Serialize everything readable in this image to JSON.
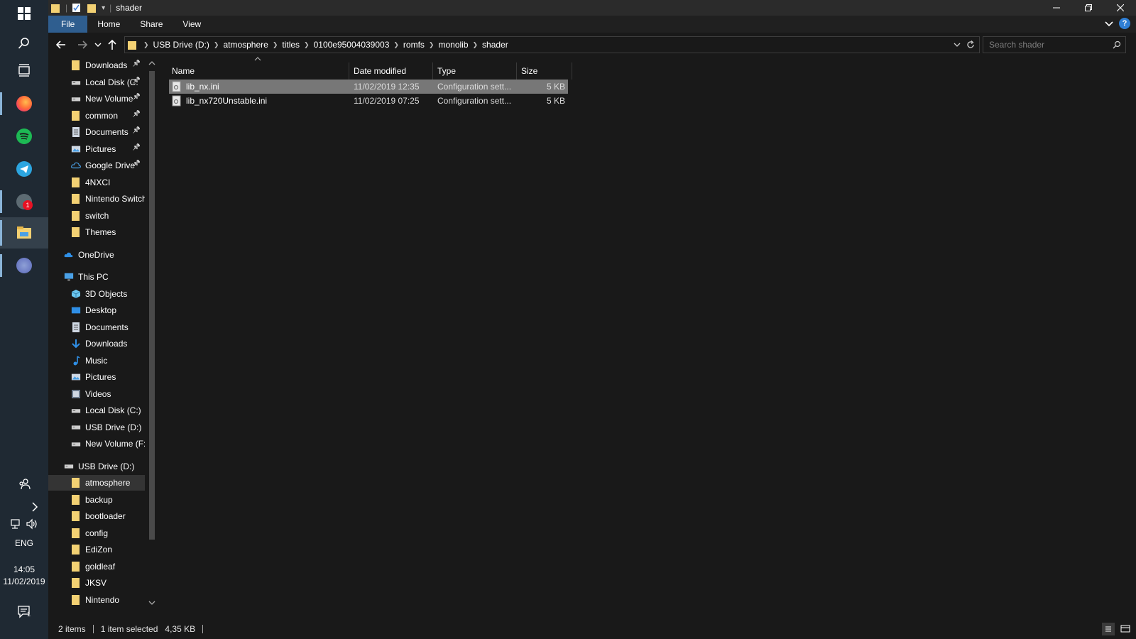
{
  "window": {
    "title": "shader"
  },
  "ribbon": {
    "tabs": [
      "File",
      "Home",
      "Share",
      "View"
    ]
  },
  "breadcrumb": [
    "USB Drive (D:)",
    "atmosphere",
    "titles",
    "0100e95004039003",
    "romfs",
    "monolib",
    "shader"
  ],
  "search": {
    "placeholder": "Search shader"
  },
  "nav": {
    "quick_access": [
      {
        "label": "Downloads",
        "pinned": true
      },
      {
        "label": "Local Disk (C:",
        "pinned": true
      },
      {
        "label": "New Volume",
        "pinned": true
      },
      {
        "label": "common",
        "pinned": true
      },
      {
        "label": "Documents",
        "pinned": true
      },
      {
        "label": "Pictures",
        "pinned": true
      },
      {
        "label": "Google Drive",
        "pinned": true
      },
      {
        "label": "4NXCI",
        "pinned": false
      },
      {
        "label": "Nintendo Switch",
        "pinned": false
      },
      {
        "label": "switch",
        "pinned": false
      },
      {
        "label": "Themes",
        "pinned": false
      }
    ],
    "onedrive": "OneDrive",
    "this_pc": "This PC",
    "this_pc_items": [
      "3D Objects",
      "Desktop",
      "Documents",
      "Downloads",
      "Music",
      "Pictures",
      "Videos",
      "Local Disk (C:)",
      "USB Drive (D:)",
      "New Volume (F:)"
    ],
    "usb_drive": "USB Drive (D:)",
    "usb_items": [
      "atmosphere",
      "backup",
      "bootloader",
      "config",
      "EdiZon",
      "goldleaf",
      "JKSV",
      "Nintendo"
    ]
  },
  "columns": [
    "Name",
    "Date modified",
    "Type",
    "Size"
  ],
  "files": [
    {
      "name": "lib_nx.ini",
      "date": "11/02/2019 12:35",
      "type": "Configuration sett...",
      "size": "5 KB",
      "selected": true
    },
    {
      "name": "lib_nx720Unstable.ini",
      "date": "11/02/2019 07:25",
      "type": "Configuration sett...",
      "size": "5 KB",
      "selected": false
    }
  ],
  "status": {
    "items": "2 items",
    "selected": "1 item selected",
    "size": "4,35 KB"
  },
  "tray": {
    "lang": "ENG",
    "time": "14:05",
    "date": "11/02/2019",
    "notif_count": "1",
    "chat_badge": "1"
  },
  "colors": {
    "accent": "#2f5e8f",
    "selected_row": "#777777",
    "folder": "#f3d173"
  }
}
